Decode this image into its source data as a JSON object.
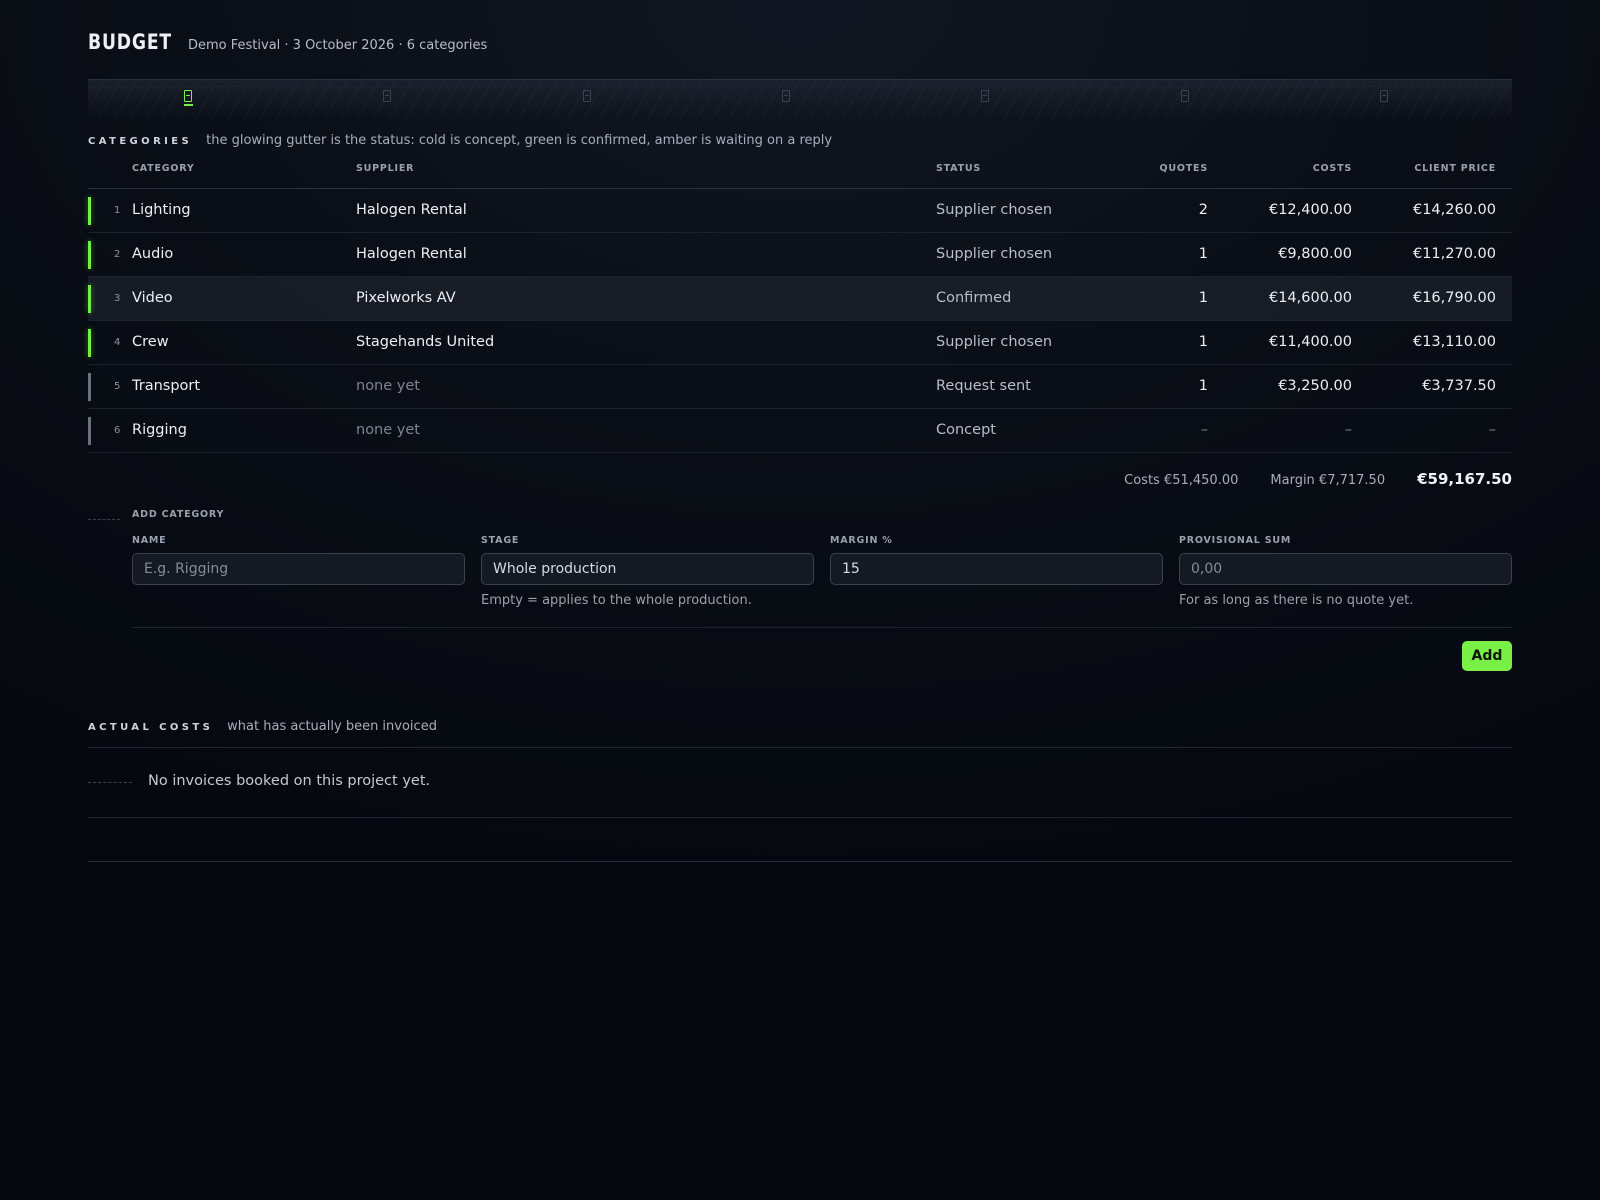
{
  "header": {
    "title": "BUDGET",
    "subtitle": "Demo Festival · 3 October 2026 · 6 categories"
  },
  "stage_rail": {
    "markers": 7,
    "active_index": 0
  },
  "categories_section": {
    "label": "CATEGORIES",
    "note": "the glowing gutter is the status: cold is concept, green is confirmed, amber is waiting on a reply"
  },
  "table": {
    "columns": {
      "category": "CATEGORY",
      "supplier": "SUPPLIER",
      "status": "STATUS",
      "quotes": "QUOTES",
      "costs": "COSTS",
      "client_price": "CLIENT PRICE"
    },
    "rows": [
      {
        "num": "1",
        "category": "Lighting",
        "supplier": "Halogen Rental",
        "status": "Supplier chosen",
        "quotes": "2",
        "costs": "€12,400.00",
        "client_price": "€14,260.00"
      },
      {
        "num": "2",
        "category": "Audio",
        "supplier": "Halogen Rental",
        "status": "Supplier chosen",
        "quotes": "1",
        "costs": "€9,800.00",
        "client_price": "€11,270.00"
      },
      {
        "num": "3",
        "category": "Video",
        "supplier": "Pixelworks AV",
        "status": "Confirmed",
        "quotes": "1",
        "costs": "€14,600.00",
        "client_price": "€16,790.00"
      },
      {
        "num": "4",
        "category": "Crew",
        "supplier": "Stagehands United",
        "status": "Supplier chosen",
        "quotes": "1",
        "costs": "€11,400.00",
        "client_price": "€13,110.00"
      },
      {
        "num": "5",
        "category": "Transport",
        "supplier": "none yet",
        "status": "Request sent",
        "quotes": "1",
        "costs": "€3,250.00",
        "client_price": "€3,737.50"
      },
      {
        "num": "6",
        "category": "Rigging",
        "supplier": "none yet",
        "status": "Concept",
        "quotes": "–",
        "costs": "–",
        "client_price": "–"
      }
    ]
  },
  "totals": {
    "costs": "Costs €51,450.00",
    "margin": "Margin €7,717.50",
    "total": "€59,167.50"
  },
  "add_category": {
    "label": "ADD CATEGORY",
    "name_label": "NAME",
    "name_placeholder": "E.g. Rigging",
    "stage_label": "STAGE",
    "stage_value": "Whole production",
    "stage_hint": "Empty = applies to the whole production.",
    "margin_label": "MARGIN %",
    "margin_value": "15",
    "sum_label": "PROVISIONAL SUM",
    "sum_placeholder": "0,00",
    "sum_hint": "For as long as there is no quote yet.",
    "add_button": "Add"
  },
  "actual_costs": {
    "label": "ACTUAL COSTS",
    "note": "what has actually been invoiced",
    "empty_text": "No invoices booked on this project yet."
  },
  "colors": {
    "accent_green": "#79f047",
    "background": "#060912",
    "gutter_cold": "#6a7180"
  }
}
